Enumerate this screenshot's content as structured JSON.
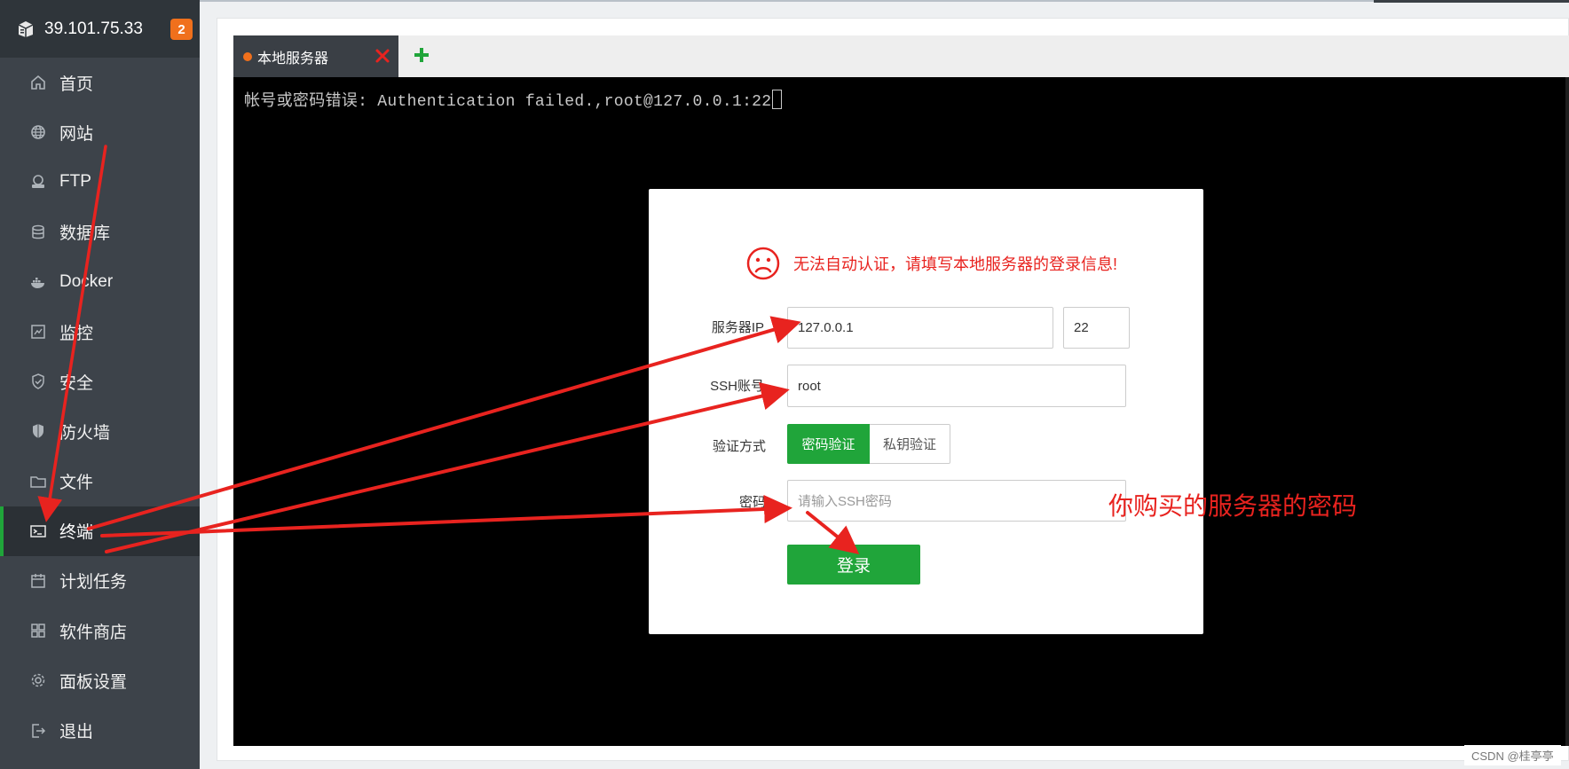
{
  "sidebar": {
    "server_ip": "39.101.75.33",
    "badge_count": "2",
    "items": [
      {
        "label": "首页",
        "icon": "home-icon"
      },
      {
        "label": "网站",
        "icon": "globe-icon"
      },
      {
        "label": "FTP",
        "icon": "ftp-icon"
      },
      {
        "label": "数据库",
        "icon": "database-icon"
      },
      {
        "label": "Docker",
        "icon": "docker-icon"
      },
      {
        "label": "监控",
        "icon": "monitor-icon"
      },
      {
        "label": "安全",
        "icon": "shield-check-icon"
      },
      {
        "label": "防火墙",
        "icon": "firewall-shield-icon"
      },
      {
        "label": "文件",
        "icon": "folder-icon"
      },
      {
        "label": "终端",
        "icon": "terminal-icon",
        "active": true
      },
      {
        "label": "计划任务",
        "icon": "calendar-icon"
      },
      {
        "label": "软件商店",
        "icon": "grid-apps-icon"
      },
      {
        "label": "面板设置",
        "icon": "gear-icon"
      },
      {
        "label": "退出",
        "icon": "logout-icon"
      }
    ]
  },
  "tabs": {
    "active_label": "本地服务器",
    "close_icon": "close-icon",
    "add_icon": "plus-icon"
  },
  "terminal": {
    "output": "帐号或密码错误: Authentication failed.,root@127.0.0.1:22"
  },
  "dialog": {
    "error_message": "无法自动认证，请填写本地服务器的登录信息!",
    "server_ip_label": "服务器IP",
    "server_ip_value": "127.0.0.1",
    "port_value": "22",
    "ssh_account_label": "SSH账号",
    "ssh_account_value": "root",
    "auth_method_label": "验证方式",
    "auth_password": "密码验证",
    "auth_key": "私钥验证",
    "password_label": "密码",
    "password_placeholder": "请输入SSH密码",
    "login_button": "登录"
  },
  "annotation": {
    "note": "你购买的服务器的密码",
    "color": "#e8231f"
  },
  "watermark": "CSDN @桂亭亭",
  "colors": {
    "sidebar_bg": "#3d434a",
    "accent_green": "#20a53a",
    "badge_orange": "#f0701c",
    "error_red": "#e8231f"
  }
}
